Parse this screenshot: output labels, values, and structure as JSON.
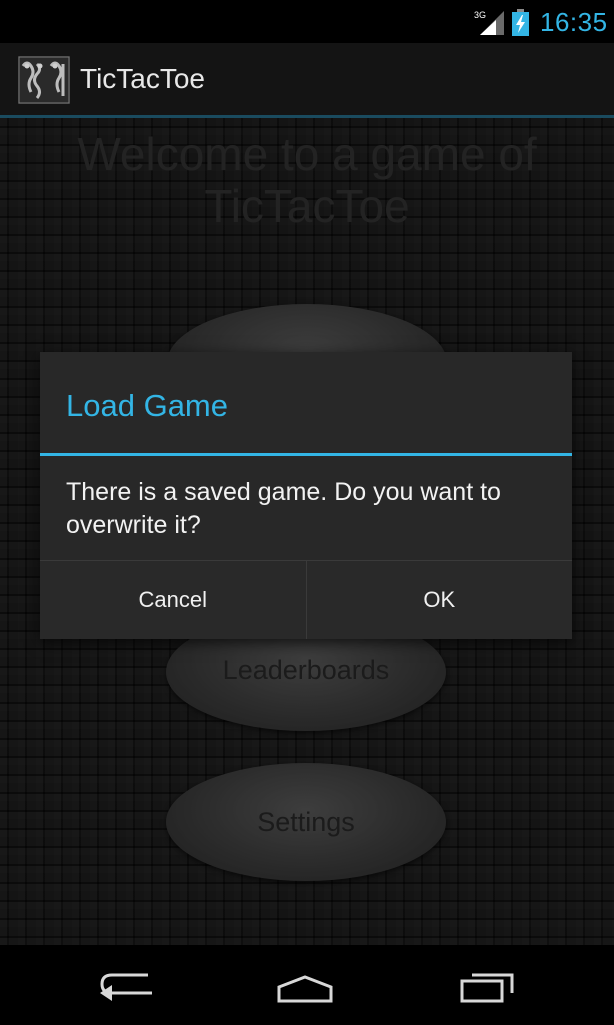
{
  "status_bar": {
    "network_label": "3G",
    "time": "16:35",
    "icons": [
      "signal-3g-icon",
      "battery-charging-icon"
    ],
    "accent_color": "#33b5e5"
  },
  "action_bar": {
    "title": "TicTacToe",
    "icon": "app-logo-icon"
  },
  "main": {
    "welcome_line1": "Welcome to a game of",
    "welcome_line2": "TicTacToe",
    "buttons": [
      {
        "label": ""
      },
      {
        "label": "Leaderboards"
      },
      {
        "label": "Settings"
      }
    ]
  },
  "dialog": {
    "title": "Load Game",
    "message": "There is a saved game. Do you want to overwrite it?",
    "cancel_label": "Cancel",
    "ok_label": "OK",
    "accent_color": "#33b5e5"
  },
  "nav_bar": {
    "icons": [
      "back-icon",
      "home-icon",
      "recent-apps-icon"
    ]
  }
}
